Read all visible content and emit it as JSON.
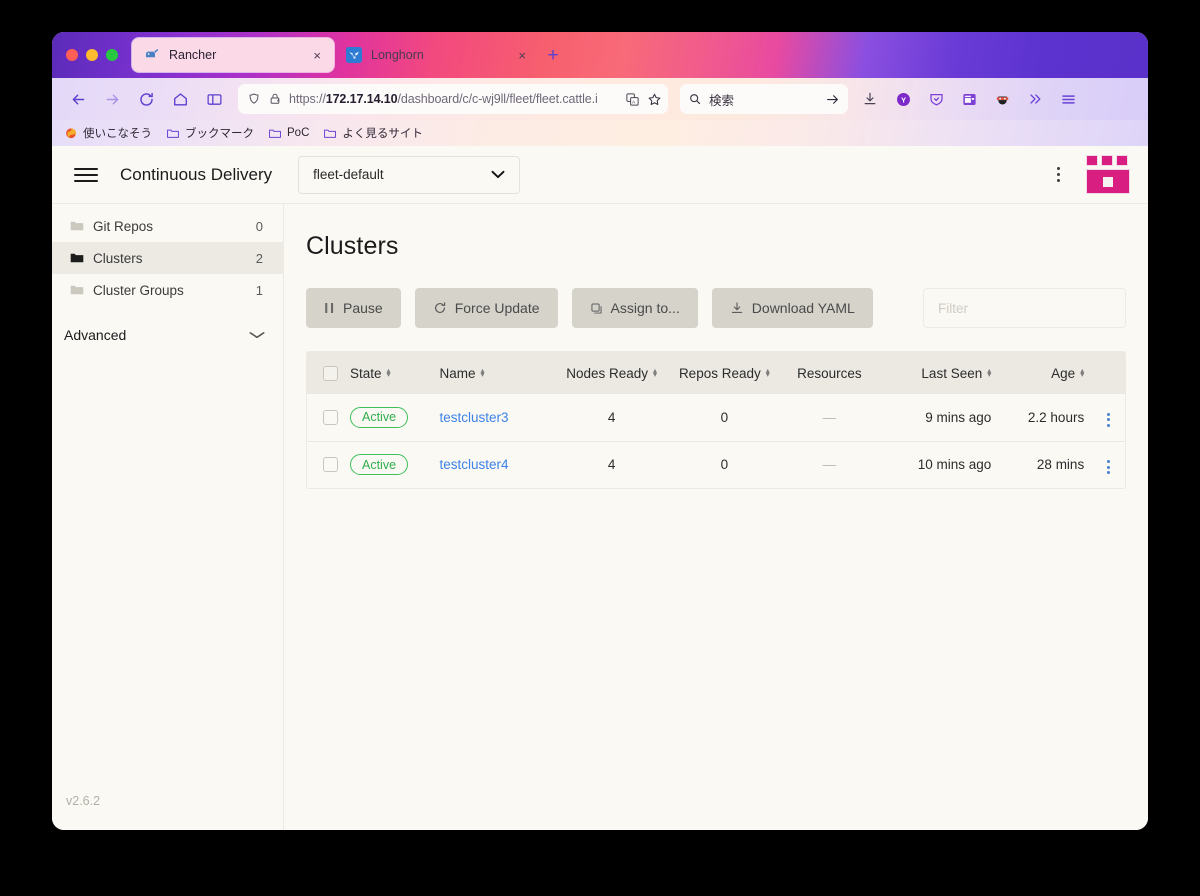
{
  "browser": {
    "tabs": [
      {
        "title": "Rancher",
        "favicon": "rancher-favicon",
        "active": true,
        "close_label": "×"
      },
      {
        "title": "Longhorn",
        "favicon": "longhorn-favicon",
        "active": false,
        "close_label": "×"
      }
    ],
    "new_tab_label": "+",
    "nav": {
      "back": "←",
      "forward": "→",
      "reload": "⟳",
      "home": "home-icon",
      "sidebar": "sidebar-icon"
    },
    "url": {
      "scheme": "https://",
      "host": "172.17.14.10",
      "path": "/dashboard/c/c-wj9ll/fleet/fleet.cattle.i",
      "full": "https://172.17.14.10/dashboard/c/c-wj9ll/fleet/fleet.cattle.i"
    },
    "search": {
      "placeholder": "検索",
      "go_label": "→"
    },
    "bookmarks": [
      {
        "label": "使いこなそう",
        "icon": "firefox-icon"
      },
      {
        "label": "ブックマーク",
        "icon": "folder-icon"
      },
      {
        "label": "PoC",
        "icon": "folder-icon"
      },
      {
        "label": "よく見るサイト",
        "icon": "folder-icon"
      }
    ]
  },
  "app": {
    "header": {
      "menu_icon": "hamburger-icon",
      "title": "Continuous Delivery",
      "namespace_value": "fleet-default",
      "overflow_icon": "kebab-icon",
      "logo": "rancher-logo"
    },
    "sidebar": {
      "items": [
        {
          "label": "Git Repos",
          "count": "0",
          "icon": "folder-icon",
          "active": false
        },
        {
          "label": "Clusters",
          "count": "2",
          "icon": "folder-filled-icon",
          "active": true
        },
        {
          "label": "Cluster Groups",
          "count": "1",
          "icon": "folder-icon",
          "active": false
        }
      ],
      "group": {
        "label": "Advanced",
        "chevron": "⌄"
      },
      "version": "v2.6.2"
    },
    "main": {
      "title": "Clusters",
      "actions": [
        {
          "label": "Pause",
          "icon": "pause-icon"
        },
        {
          "label": "Force Update",
          "icon": "refresh-icon"
        },
        {
          "label": "Assign to...",
          "icon": "copy-icon"
        },
        {
          "label": "Download YAML",
          "icon": "download-icon"
        }
      ],
      "filter_placeholder": "Filter",
      "table": {
        "columns": [
          {
            "key": "check",
            "label": "",
            "sortable": false
          },
          {
            "key": "state",
            "label": "State",
            "sortable": true
          },
          {
            "key": "name",
            "label": "Name",
            "sortable": true
          },
          {
            "key": "nodes",
            "label": "Nodes Ready",
            "sortable": true
          },
          {
            "key": "repos",
            "label": "Repos Ready",
            "sortable": true
          },
          {
            "key": "resources",
            "label": "Resources",
            "sortable": false
          },
          {
            "key": "lastseen",
            "label": "Last Seen",
            "sortable": true
          },
          {
            "key": "age",
            "label": "Age",
            "sortable": true
          },
          {
            "key": "menu",
            "label": "",
            "sortable": false
          }
        ],
        "rows": [
          {
            "state": "Active",
            "name": "testcluster3",
            "nodes": "4",
            "repos": "0",
            "resources": "—",
            "lastseen": "9 mins ago",
            "age": "2.2 hours",
            "menu": "row-kebab-icon"
          },
          {
            "state": "Active",
            "name": "testcluster4",
            "nodes": "4",
            "repos": "0",
            "resources": "—",
            "lastseen": "10 mins ago",
            "age": "28 mins",
            "menu": "row-kebab-icon"
          }
        ]
      }
    }
  },
  "colors": {
    "accent": "#d81e80",
    "link": "#3c82e8",
    "active_state": "#2fae4c",
    "page_bg": "#fbf9f4",
    "table_header_bg": "#ebe9e2",
    "button_bg": "#d6d3cb"
  }
}
